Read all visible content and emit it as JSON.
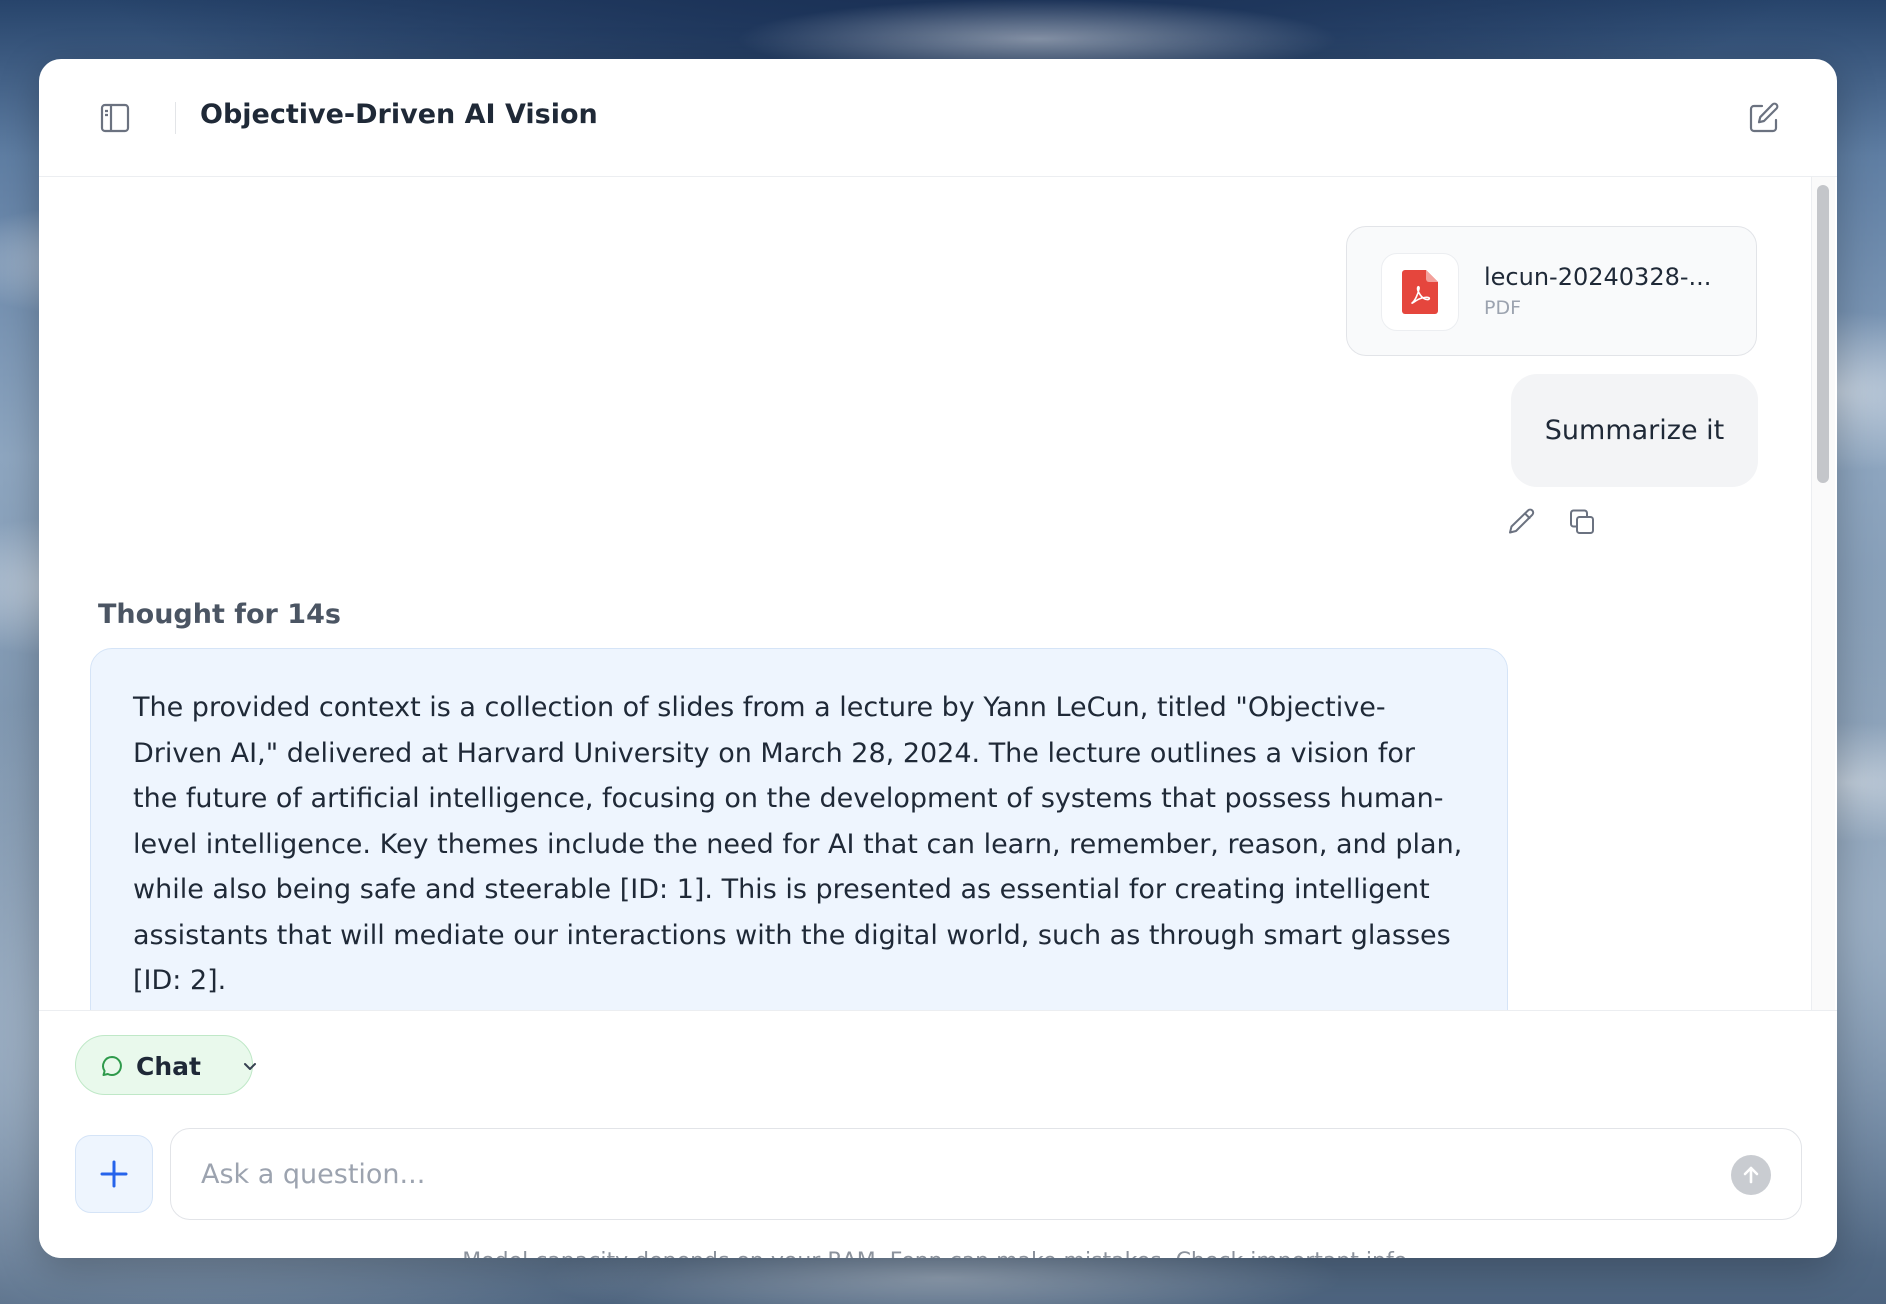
{
  "header": {
    "title": "Objective-Driven AI Vision",
    "sidebar_toggle_icon": "sidebar-icon",
    "new_chat_icon": "edit-icon"
  },
  "conversation": {
    "attachment": {
      "name": "lecun-20240328-...",
      "type": "PDF",
      "icon": "pdf-file-icon",
      "icon_color": "#e5463d"
    },
    "user_message": "Summarize it",
    "user_actions": [
      "edit-icon",
      "copy-icon"
    ],
    "thought_label": "Thought for 14s",
    "answer": "The provided context is a collection of slides from a lecture by Yann LeCun, titled \"Objective-Driven AI,\" delivered at Harvard University on March 28, 2024. The lecture outlines a vision for the future of artificial intelligence, focusing on the development of systems that possess human-level intelligence. Key themes include the need for AI that can learn, remember, reason, and plan, while also being safe and steerable [ID: 1]. This is presented as essential for creating intelligent assistants that will mediate our interactions with the digital world, such as through smart glasses [ID: 2]."
  },
  "composer": {
    "mode_label": "Chat",
    "mode_color": "#e9f9ec",
    "placeholder": "Ask a question...",
    "value": "",
    "disclaimer": "Model capacity depends on your RAM. Fenn can make mistakes. Check important info."
  },
  "colors": {
    "accent": "#2563eb",
    "answer_bg": "#eef5fe",
    "send_disabled": "#c9ccd1"
  }
}
